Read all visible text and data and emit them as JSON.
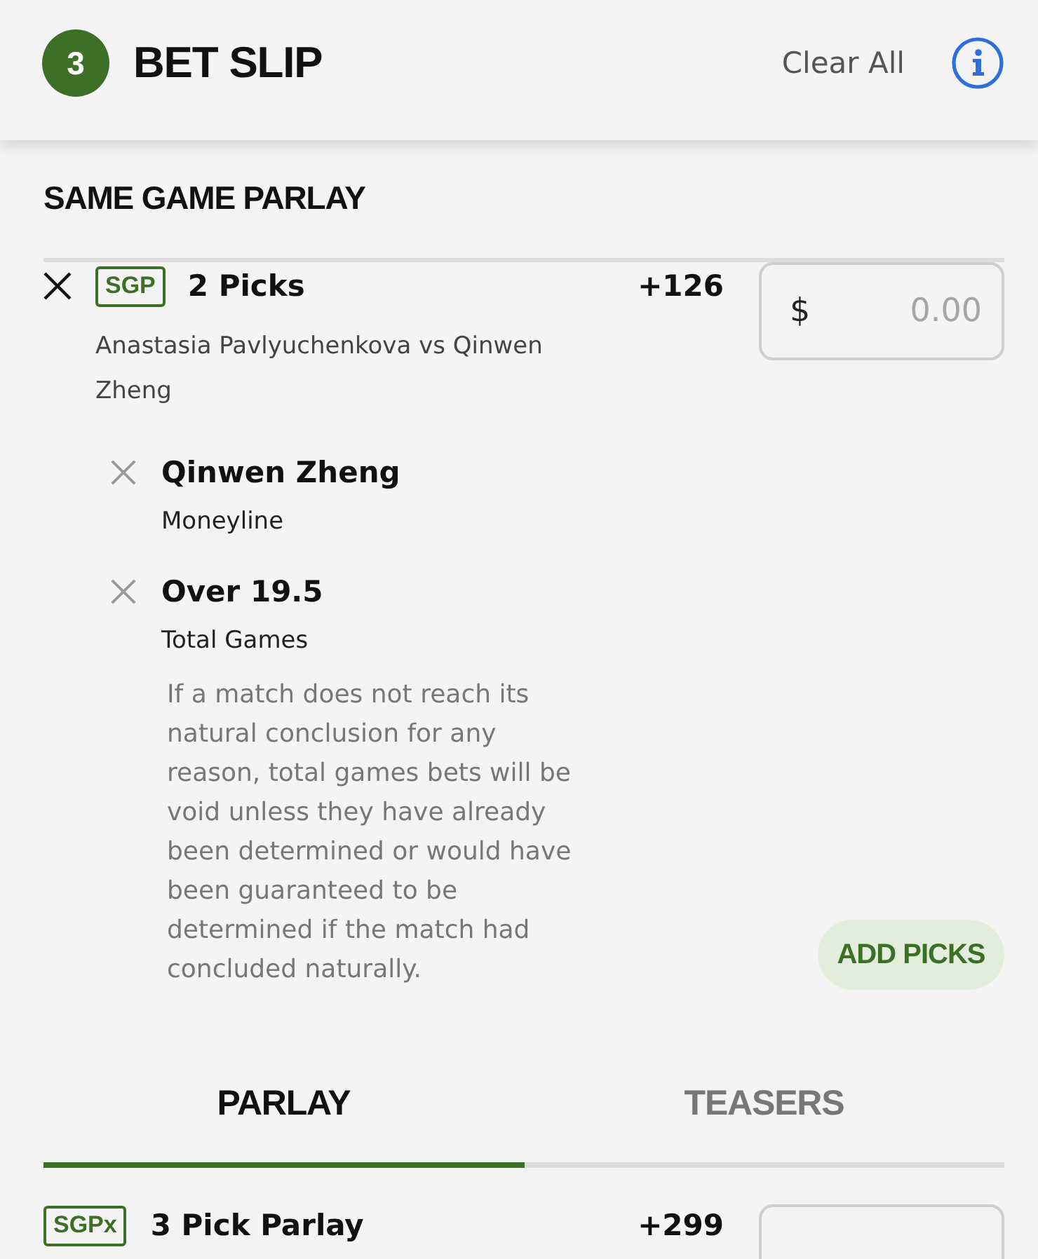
{
  "header": {
    "count": "3",
    "title": "BET SLIP",
    "clear_all": "Clear All"
  },
  "section_title": "SAME GAME PARLAY",
  "sgp_bet": {
    "badge": "SGP",
    "title": "2 Picks",
    "odds": "+126",
    "stake": {
      "currency": "$",
      "placeholder": "0.00"
    },
    "event": "Anastasia Pavlyuchenkova vs Qinwen Zheng",
    "legs": [
      {
        "selection": "Qinwen Zheng",
        "market": "Moneyline"
      },
      {
        "selection": "Over 19.5",
        "market": "Total Games",
        "note": "If a match does not reach its natural conclusion for any reason, total games bets will be void unless they have already been determined or would have been guaranteed to be determined if the match had concluded naturally."
      }
    ],
    "add_picks": "ADD PICKS"
  },
  "tabs": [
    {
      "label": "PARLAY",
      "selected": true
    },
    {
      "label": "TEASERS",
      "selected": false
    }
  ],
  "parlay_bet": {
    "badge": "SGPx",
    "title": "3 Pick Parlay",
    "odds": "+299"
  }
}
